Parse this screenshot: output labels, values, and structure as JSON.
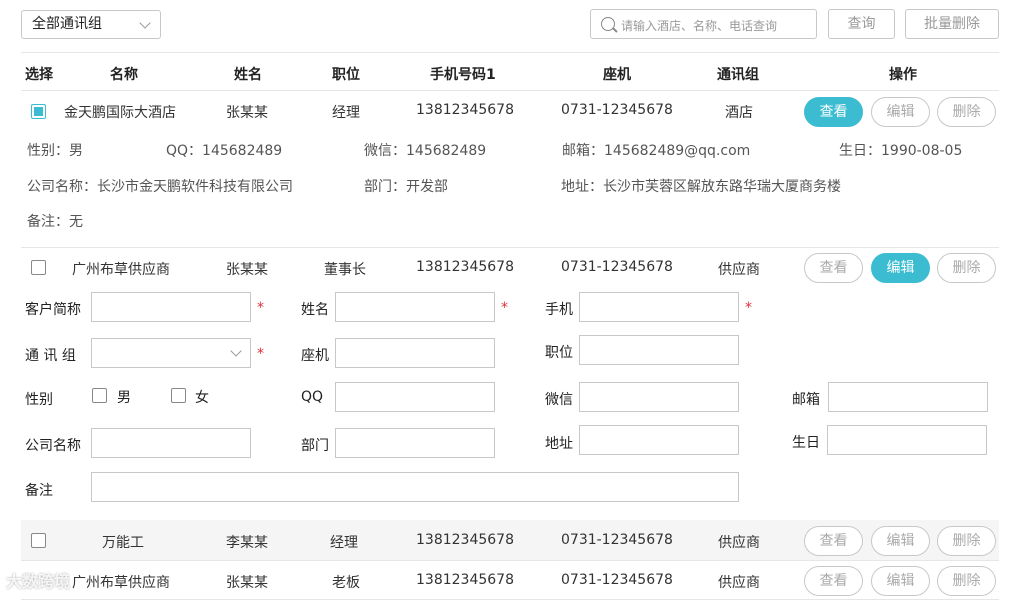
{
  "toolbar": {
    "group_select": "全部通讯组",
    "search_placeholder": "请输入酒店、名称、电话查询",
    "query_label": "查询",
    "batch_delete_label": "批量删除"
  },
  "headers": [
    "选择",
    "名称",
    "姓名",
    "职位",
    "手机号码1",
    "座机",
    "通讯组",
    "操作"
  ],
  "actions": {
    "view": "查看",
    "edit": "编辑",
    "delete": "删除"
  },
  "rows": [
    {
      "checked": true,
      "name": "金天鹏国际大酒店",
      "person": "张某某",
      "title": "经理",
      "mobile": "13812345678",
      "phone": "0731-12345678",
      "group": "酒店"
    },
    {
      "checked": false,
      "name": "广州布草供应商",
      "person": "张某某",
      "title": "董事长",
      "mobile": "13812345678",
      "phone": "0731-12345678",
      "group": "供应商"
    },
    {
      "checked": false,
      "name": "万能工",
      "person": "李某某",
      "title": "经理",
      "mobile": "13812345678",
      "phone": "0731-12345678",
      "group": "供应商"
    },
    {
      "checked": false,
      "name": "广州布草供应商",
      "person": "张某某",
      "title": "老板",
      "mobile": "13812345678",
      "phone": "0731-12345678",
      "group": "供应商"
    }
  ],
  "detail": {
    "gender": "性别：男",
    "qq": "QQ：145682489",
    "wechat": "微信：145682489",
    "email": "邮箱：145682489@qq.com",
    "birthday": "生日：1990-08-05",
    "company": "公司名称：长沙市金天鹏软件科技有限公司",
    "dept": "部门：开发部",
    "address": "地址：长沙市芙蓉区解放东路华瑞大厦商务楼",
    "note": "备注：无"
  },
  "form": {
    "customer_short": "客户简称",
    "name": "姓名",
    "mobile": "手机",
    "group": "通 讯 组",
    "phone": "座机",
    "position": "职位",
    "gender": "性别",
    "male": "男",
    "female": "女",
    "qq": "QQ",
    "wechat": "微信",
    "email": "邮箱",
    "company": "公司名称",
    "dept": "部门",
    "address": "地址",
    "birthday": "生日",
    "note": "备注",
    "required_mark": "*"
  },
  "watermark": "大数跨境",
  "colors": {
    "accent": "#3bbcd0",
    "required": "#e0303a"
  }
}
